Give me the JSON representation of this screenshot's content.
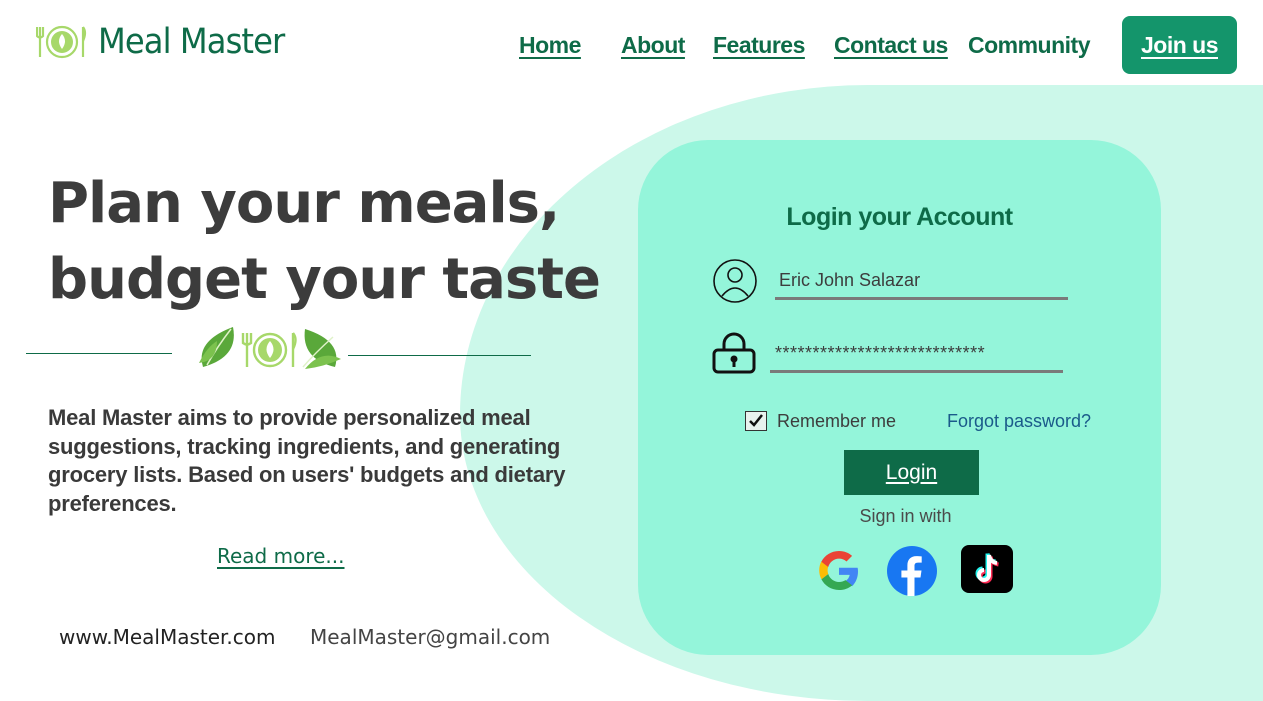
{
  "header": {
    "logo_text": "Meal Master",
    "nav": [
      "Home",
      "About",
      "Features",
      "Contact us",
      "Community"
    ],
    "join_label": "Join us"
  },
  "hero": {
    "title_line1": "Plan your meals,",
    "title_line2": "budget your taste",
    "description": "Meal Master aims to provide personalized meal suggestions, tracking ingredients, and generating grocery lists. Based on users' budgets and dietary preferences.",
    "read_more": "Read more...",
    "website": "www.MealMaster.com",
    "email": "MealMaster@gmail.com"
  },
  "login": {
    "title": "Login your Account",
    "username_value": "Eric John Salazar",
    "password_value": "****************************",
    "remember_label": "Remember me",
    "remember_checked": true,
    "forgot_label": "Forgot password?",
    "login_label": "Login",
    "signin_with": "Sign in with",
    "social": [
      "google-icon",
      "facebook-icon",
      "tiktok-icon"
    ]
  },
  "colors": {
    "brand_green": "#0e6b48",
    "button_green": "#14956b",
    "card_mint": "#94f5da",
    "bg_mint": "#ccf8ea"
  }
}
